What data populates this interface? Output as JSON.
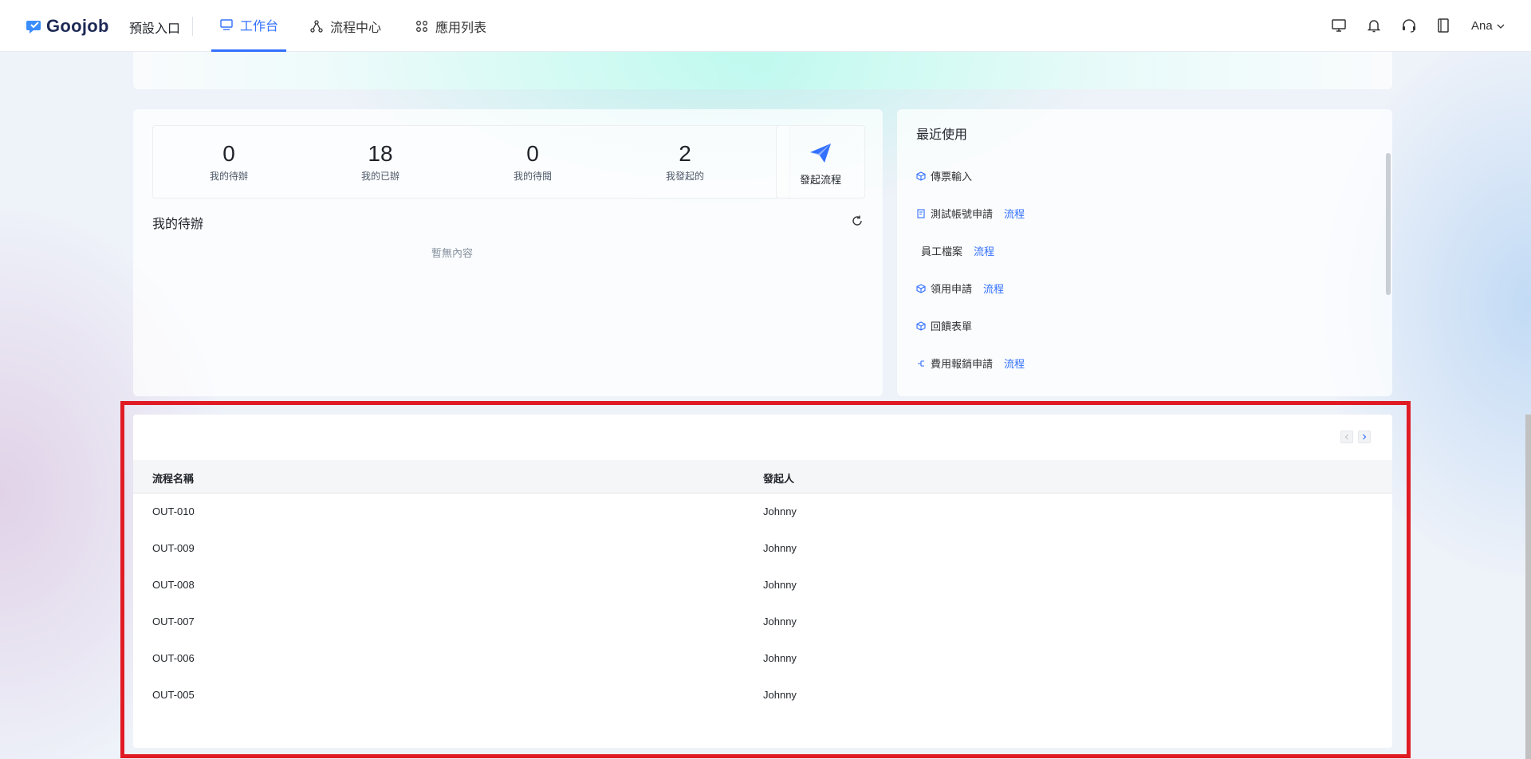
{
  "brand": {
    "name": "Goojob"
  },
  "header": {
    "entry": "預設入口",
    "tabs": [
      {
        "label": "工作台",
        "icon": "monitor-icon",
        "active": true
      },
      {
        "label": "流程中心",
        "icon": "flow-icon",
        "active": false
      },
      {
        "label": "應用列表",
        "icon": "apps-icon",
        "active": false
      }
    ],
    "user": "Ana",
    "accent": "#3370ff"
  },
  "stats": [
    {
      "value": "0",
      "label": "我的待辦"
    },
    {
      "value": "18",
      "label": "我的已辦"
    },
    {
      "value": "0",
      "label": "我的待閱"
    },
    {
      "value": "2",
      "label": "我發起的"
    }
  ],
  "launch": {
    "label": "發起流程",
    "icon": "paper-plane-icon"
  },
  "todo": {
    "title": "我的待辦",
    "empty": "暫無內容"
  },
  "recent": {
    "title": "最近使用",
    "items": [
      {
        "label": "傳票輸入",
        "tag": "",
        "icon": "cube-icon"
      },
      {
        "label": "測試帳號申請",
        "tag": "流程",
        "icon": "form-icon"
      },
      {
        "label": "員工檔案",
        "tag": "流程",
        "icon": ""
      },
      {
        "label": "領用申請",
        "tag": "流程",
        "icon": "cube-icon"
      },
      {
        "label": "回饋表單",
        "tag": "",
        "icon": "cube-icon"
      },
      {
        "label": "費用報銷申請",
        "tag": "流程",
        "icon": "flow-icon"
      }
    ]
  },
  "table": {
    "columns": [
      "流程名稱",
      "發起人"
    ],
    "rows": [
      [
        "OUT-010",
        "Johnny"
      ],
      [
        "OUT-009",
        "Johnny"
      ],
      [
        "OUT-008",
        "Johnny"
      ],
      [
        "OUT-007",
        "Johnny"
      ],
      [
        "OUT-006",
        "Johnny"
      ],
      [
        "OUT-005",
        "Johnny"
      ]
    ]
  }
}
